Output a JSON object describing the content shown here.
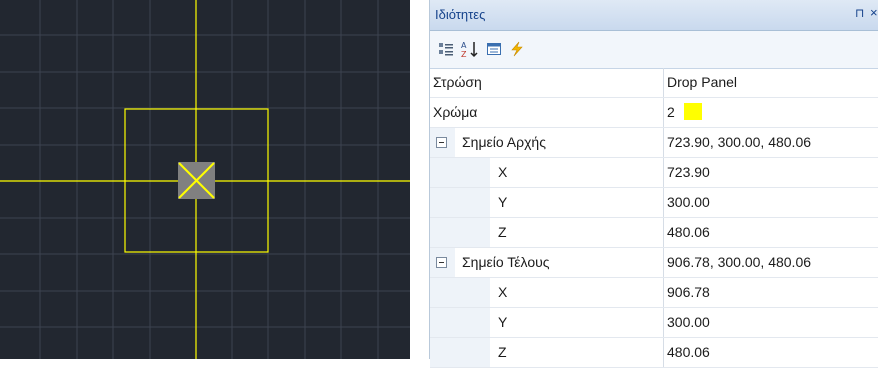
{
  "viewport": {
    "colors": {
      "background": "#222730",
      "grid": "#3c4350",
      "entity": "#ffff00",
      "marker": "#808080"
    }
  },
  "properties": {
    "title": "Ιδιότητες",
    "pin_glyph": "⊓",
    "close_glyph": "×",
    "toolbar": {
      "categorized_icon": "categorized-icon",
      "alphabetical_icon": "sort-az-icon",
      "property_pages_icon": "property-pages-icon",
      "events_icon": "lightning-icon"
    },
    "rows": {
      "layer": {
        "name": "Στρώση",
        "value": "Drop Panel"
      },
      "color": {
        "name": "Χρώμα",
        "value": "2",
        "swatch": "#ffff00"
      },
      "start_point": {
        "name": "Σημείο Αρχής",
        "value": "723.90, 300.00, 480.06",
        "x": {
          "name": "X",
          "value": "723.90"
        },
        "y": {
          "name": "Y",
          "value": "300.00"
        },
        "z": {
          "name": "Z",
          "value": "480.06"
        }
      },
      "end_point": {
        "name": "Σημείο Τέλους",
        "value": "906.78, 300.00, 480.06",
        "x": {
          "name": "X",
          "value": "906.78"
        },
        "y": {
          "name": "Y",
          "value": "300.00"
        },
        "z": {
          "name": "Z",
          "value": "480.06"
        }
      }
    }
  }
}
